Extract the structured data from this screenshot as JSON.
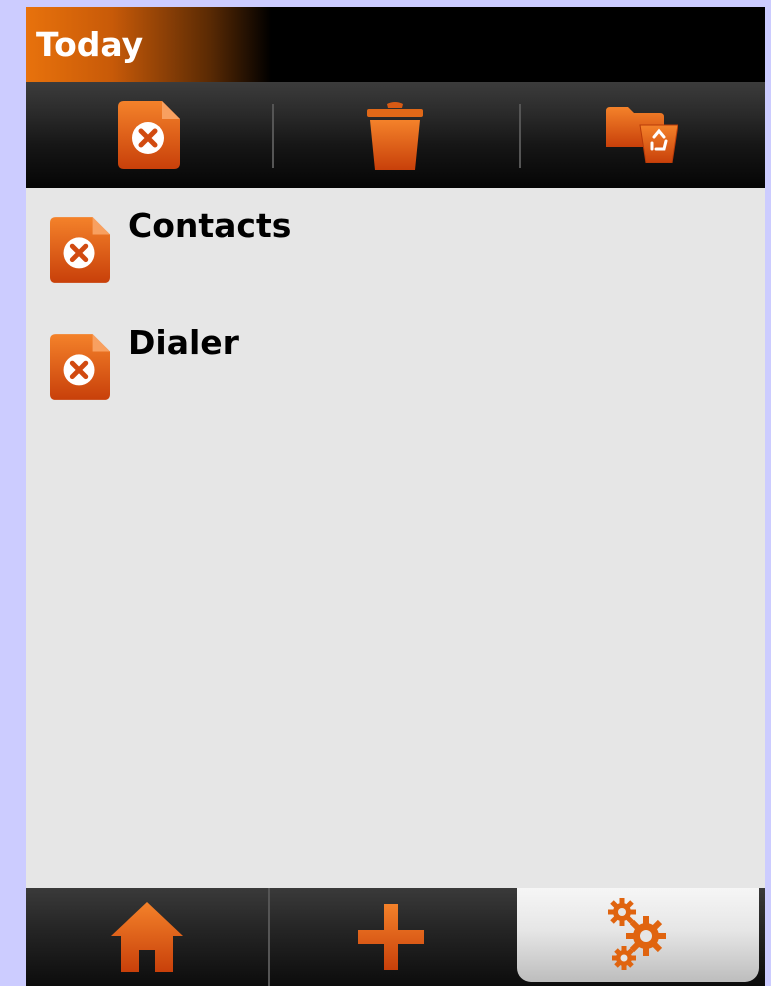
{
  "header": {
    "title": "Today"
  },
  "toolbar": {
    "buttons": [
      {
        "icon": "remove-file-icon"
      },
      {
        "icon": "trash-can-icon"
      },
      {
        "icon": "recycle-folder-icon"
      }
    ]
  },
  "list": {
    "items": [
      {
        "label": "Contacts",
        "icon": "remove-file-icon"
      },
      {
        "label": "Dialer",
        "icon": "remove-file-icon"
      }
    ]
  },
  "bottom_nav": {
    "tabs": [
      {
        "icon": "home-icon",
        "active": false
      },
      {
        "icon": "plus-icon",
        "active": false
      },
      {
        "icon": "gears-icon",
        "active": true
      }
    ]
  },
  "colors": {
    "accent": "#e8720c",
    "accent_dark": "#c2410a",
    "background": "#e6e6e6",
    "frame": "#ccccff"
  }
}
